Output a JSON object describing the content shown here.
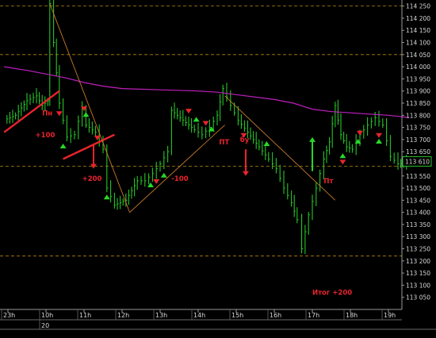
{
  "chart_data": {
    "type": "line",
    "title": "",
    "xlabel": "",
    "ylabel": "",
    "ylim": [
      113.0,
      114.275
    ],
    "date_label": "20",
    "x_ticks": [
      "23h",
      "10h",
      "11h",
      "12h",
      "13h",
      "14h",
      "15h",
      "16h",
      "17h",
      "18h",
      "19h"
    ],
    "y_ticks": [
      "114 250",
      "114 200",
      "114 150",
      "114 100",
      "114 050",
      "114 000",
      "113 950",
      "113 900",
      "113 850",
      "113 800",
      "113 750",
      "113 700",
      "113 650",
      "113 600",
      "113 550",
      "113 500",
      "113 450",
      "113 400",
      "113 350",
      "113 300",
      "113 250",
      "113 200",
      "113 150",
      "113 100",
      "113 050"
    ],
    "y_tick_values": [
      114.25,
      114.2,
      114.15,
      114.1,
      114.05,
      114.0,
      113.95,
      113.9,
      113.85,
      113.8,
      113.75,
      113.7,
      113.65,
      113.6,
      113.55,
      113.5,
      113.45,
      113.4,
      113.35,
      113.3,
      113.25,
      113.2,
      113.15,
      113.1,
      113.05
    ],
    "current_price_label": "113 610",
    "current_price": 113.61,
    "h_levels": [
      114.25,
      114.05,
      113.59,
      113.22
    ],
    "price_series": [
      [
        -0.1,
        113.78
      ],
      [
        0.2,
        113.8
      ],
      [
        0.5,
        113.86
      ],
      [
        0.75,
        113.88
      ],
      [
        0.9,
        113.84
      ],
      [
        1.05,
        113.86
      ],
      [
        1.1,
        114.26
      ],
      [
        1.2,
        114.1
      ],
      [
        1.35,
        113.85
      ],
      [
        1.55,
        113.71
      ],
      [
        1.75,
        113.72
      ],
      [
        1.95,
        113.83
      ],
      [
        2.05,
        113.76
      ],
      [
        2.3,
        113.73
      ],
      [
        2.5,
        113.66
      ],
      [
        2.6,
        113.5
      ],
      [
        2.8,
        113.43
      ],
      [
        3.1,
        113.45
      ],
      [
        3.4,
        113.53
      ],
      [
        3.6,
        113.53
      ],
      [
        3.8,
        113.56
      ],
      [
        4.0,
        113.6
      ],
      [
        4.2,
        113.65
      ],
      [
        4.3,
        113.82
      ],
      [
        4.6,
        113.78
      ],
      [
        4.9,
        113.74
      ],
      [
        5.1,
        113.72
      ],
      [
        5.3,
        113.75
      ],
      [
        5.5,
        113.8
      ],
      [
        5.65,
        113.91
      ],
      [
        5.85,
        113.84
      ],
      [
        6.05,
        113.78
      ],
      [
        6.3,
        113.73
      ],
      [
        6.6,
        113.67
      ],
      [
        6.85,
        113.62
      ],
      [
        7.05,
        113.58
      ],
      [
        7.25,
        113.5
      ],
      [
        7.45,
        113.44
      ],
      [
        7.6,
        113.37
      ],
      [
        7.72,
        113.25
      ],
      [
        7.9,
        113.39
      ],
      [
        8.1,
        113.5
      ],
      [
        8.3,
        113.62
      ],
      [
        8.45,
        113.69
      ],
      [
        8.6,
        113.84
      ],
      [
        8.75,
        113.72
      ],
      [
        8.9,
        113.67
      ],
      [
        9.05,
        113.66
      ],
      [
        9.25,
        113.72
      ],
      [
        9.45,
        113.76
      ],
      [
        9.65,
        113.79
      ],
      [
        9.85,
        113.76
      ],
      [
        10.05,
        113.63
      ],
      [
        10.25,
        113.6
      ],
      [
        10.4,
        113.6
      ],
      [
        10.55,
        113.61
      ]
    ],
    "ma_series": [
      [
        -0.1,
        114.0
      ],
      [
        0.5,
        113.985
      ],
      [
        1.0,
        113.97
      ],
      [
        1.5,
        113.955
      ],
      [
        2.0,
        113.935
      ],
      [
        2.5,
        113.92
      ],
      [
        3.0,
        113.91
      ],
      [
        4.0,
        113.905
      ],
      [
        5.0,
        113.9
      ],
      [
        5.5,
        113.895
      ],
      [
        6.0,
        113.885
      ],
      [
        7.0,
        113.865
      ],
      [
        7.5,
        113.85
      ],
      [
        8.0,
        113.825
      ],
      [
        8.5,
        113.815
      ],
      [
        9.0,
        113.81
      ],
      [
        9.5,
        113.805
      ],
      [
        10.0,
        113.8
      ],
      [
        10.3,
        113.795
      ],
      [
        10.55,
        113.79
      ]
    ],
    "trend_lines": [
      {
        "color": "#e8242c",
        "from": [
          -0.1,
          113.73
        ],
        "to": [
          1.35,
          113.9
        ]
      },
      {
        "color": "#e8242c",
        "from": [
          1.45,
          113.62
        ],
        "to": [
          2.8,
          113.72
        ]
      },
      {
        "color": "#c87a2a",
        "from": [
          1.1,
          114.26
        ],
        "to": [
          3.2,
          113.4
        ]
      },
      {
        "color": "#c87a2a",
        "from": [
          3.2,
          113.4
        ],
        "to": [
          5.7,
          113.76
        ]
      },
      {
        "color": "#c87a2a",
        "from": [
          5.7,
          113.88
        ],
        "to": [
          8.6,
          113.45
        ]
      }
    ],
    "markers": [
      {
        "type": "buy",
        "x": 1.45,
        "y": 113.67
      },
      {
        "type": "buy",
        "x": 2.05,
        "y": 113.8
      },
      {
        "type": "buy",
        "x": 2.6,
        "y": 113.46
      },
      {
        "type": "buy",
        "x": 3.75,
        "y": 113.51
      },
      {
        "type": "buy",
        "x": 4.1,
        "y": 113.55
      },
      {
        "type": "buy",
        "x": 4.95,
        "y": 113.78
      },
      {
        "type": "buy",
        "x": 5.35,
        "y": 113.74
      },
      {
        "type": "buy",
        "x": 6.8,
        "y": 113.68
      },
      {
        "type": "buy",
        "x": 8.8,
        "y": 113.63
      },
      {
        "type": "buy",
        "x": 9.2,
        "y": 113.69
      },
      {
        "type": "buy",
        "x": 9.75,
        "y": 113.69
      },
      {
        "type": "sell",
        "x": 1.35,
        "y": 113.81
      },
      {
        "type": "sell",
        "x": 2.0,
        "y": 113.83
      },
      {
        "type": "sell",
        "x": 2.35,
        "y": 113.71
      },
      {
        "type": "sell",
        "x": 3.9,
        "y": 113.53
      },
      {
        "type": "sell",
        "x": 4.75,
        "y": 113.82
      },
      {
        "type": "sell",
        "x": 5.2,
        "y": 113.77
      },
      {
        "type": "sell",
        "x": 6.2,
        "y": 113.72
      },
      {
        "type": "sell",
        "x": 8.8,
        "y": 113.61
      },
      {
        "type": "sell",
        "x": 9.25,
        "y": 113.73
      },
      {
        "type": "sell",
        "x": 9.75,
        "y": 113.72
      }
    ],
    "arrows": [
      {
        "color": "#e8242c",
        "x": 2.25,
        "y_from": 113.68,
        "y_to": 113.58
      },
      {
        "color": "#e8242c",
        "x": 6.25,
        "y_from": 113.66,
        "y_to": 113.55
      },
      {
        "color": "#27d827",
        "x": 8.0,
        "y_from": 113.57,
        "y_to": 113.71
      }
    ],
    "annotations": [
      {
        "text": "Пн",
        "x": 0.9,
        "y": 113.8,
        "color": "#e8242c"
      },
      {
        "text": "+100",
        "x": 0.72,
        "y": 113.71,
        "color": "#e8242c"
      },
      {
        "text": "+200",
        "x": 1.95,
        "y": 113.53,
        "color": "#e8242c"
      },
      {
        "text": "-100",
        "x": 4.3,
        "y": 113.53,
        "color": "#e8242c"
      },
      {
        "text": "ПТ",
        "x": 5.55,
        "y": 113.68,
        "color": "#e8242c"
      },
      {
        "text": "бу",
        "x": 6.1,
        "y": 113.69,
        "color": "#e8242c"
      },
      {
        "text": "Пт",
        "x": 8.3,
        "y": 113.52,
        "color": "#e8242c"
      },
      {
        "text": "Итог +200",
        "x": 8.0,
        "y": 113.06,
        "color": "#e8242c"
      }
    ],
    "colors": {
      "background": "#000000",
      "price": "#27c427",
      "moving_average": "#c020c0",
      "level": "#b8860b",
      "grid": "#3a3a3a",
      "axis_text": "#d8d8d8",
      "buy_marker": "#27d827",
      "sell_marker": "#e8242c"
    }
  }
}
